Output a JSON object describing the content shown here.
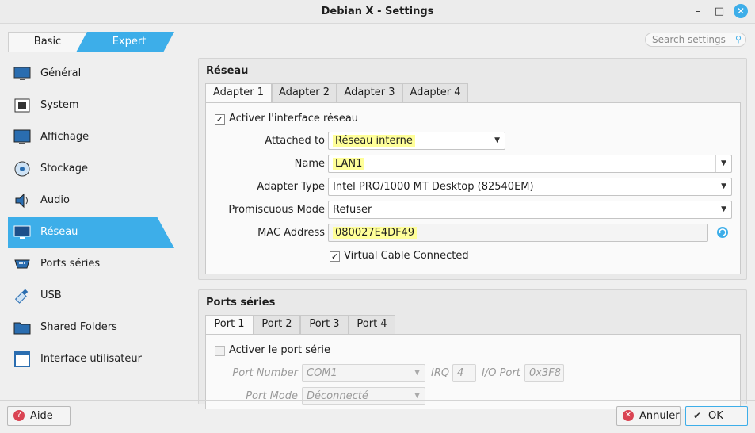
{
  "window": {
    "title": "Debian X - Settings",
    "min": "–",
    "max": "□",
    "close": "✕"
  },
  "mode": {
    "basic": "Basic",
    "expert": "Expert"
  },
  "search": {
    "placeholder": "Search settings"
  },
  "sidebar": {
    "items": [
      {
        "label": "Général",
        "icon": "monitor-icon"
      },
      {
        "label": "System",
        "icon": "chip-icon"
      },
      {
        "label": "Affichage",
        "icon": "display-icon"
      },
      {
        "label": "Stockage",
        "icon": "disk-icon"
      },
      {
        "label": "Audio",
        "icon": "speaker-icon"
      },
      {
        "label": "Réseau",
        "icon": "network-icon",
        "active": true
      },
      {
        "label": "Ports séries",
        "icon": "serial-port-icon"
      },
      {
        "label": "USB",
        "icon": "usb-icon"
      },
      {
        "label": "Shared Folders",
        "icon": "folder-icon"
      },
      {
        "label": "Interface utilisateur",
        "icon": "window-icon"
      }
    ]
  },
  "network": {
    "title": "Réseau",
    "tabs": [
      "Adapter 1",
      "Adapter 2",
      "Adapter 3",
      "Adapter 4"
    ],
    "enable_label": "Activer l'interface réseau",
    "enable_checked": true,
    "attached_label": "Attached to",
    "attached_value": "Réseau interne",
    "name_label": "Name",
    "name_value": "LAN1",
    "adapter_type_label": "Adapter Type",
    "adapter_type_value": "Intel PRO/1000 MT Desktop (82540EM)",
    "promisc_label": "Promiscuous Mode",
    "promisc_value": "Refuser",
    "mac_label": "MAC Address",
    "mac_value": "080027E4DF49",
    "cable_label": "Virtual Cable Connected",
    "cable_checked": true
  },
  "serial": {
    "title": "Ports séries",
    "tabs": [
      "Port 1",
      "Port 2",
      "Port 3",
      "Port 4"
    ],
    "enable_label": "Activer le port série",
    "enable_checked": false,
    "port_number_label": "Port Number",
    "port_number_value": "COM1",
    "irq_label": "IRQ",
    "irq_value": "4",
    "io_port_label": "I/O Port",
    "io_port_value": "0x3F8",
    "port_mode_label": "Port Mode",
    "port_mode_value": "Déconnecté"
  },
  "footer": {
    "help": "Aide",
    "cancel": "Annuler",
    "ok": "OK"
  },
  "colors": {
    "accent": "#3daee9",
    "highlight": "#ffff99"
  }
}
